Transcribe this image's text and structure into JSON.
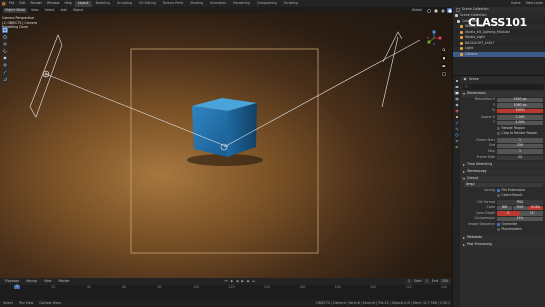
{
  "menu": {
    "items": [
      "File",
      "Edit",
      "Render",
      "Window",
      "Help"
    ],
    "workspaces": [
      "Layout",
      "Modeling",
      "Sculpting",
      "UV Editing",
      "Texture Paint",
      "Shading",
      "Animation",
      "Rendering",
      "Compositing",
      "Scripting"
    ],
    "active_workspace": "Layout",
    "scene": "Scene",
    "view_layer": "View Layer"
  },
  "viewport": {
    "mode": "Object Mode",
    "menus": [
      "View",
      "Select",
      "Add",
      "Object"
    ],
    "orientation": "Global",
    "info_lines": [
      "Camera Perspective",
      "(1) OBJECTS | Camera",
      "Rendering Done"
    ]
  },
  "timeline": {
    "playback": "Playback",
    "keying": "Keying",
    "view": "View",
    "marker": "Marker",
    "current_frame": "1",
    "start_label": "Start",
    "start": "1",
    "end_label": "End",
    "end": "250",
    "ticks": [
      "0",
      "20",
      "40",
      "60",
      "80",
      "100",
      "120",
      "140",
      "160",
      "180",
      "200",
      "220",
      "240"
    ]
  },
  "status": {
    "items": [
      "Select",
      "Pan View",
      "Context Menu"
    ],
    "version": "OBJECTS | Camera | Verts:8 | Faces:6 | Tris:12 | Objects:1/5 | Mem: 32.7 MiB | 2.90.1"
  },
  "watermark": "CLASS101",
  "outliner": {
    "title": "Scene Collection",
    "items": [
      {
        "label": "Scene Collection",
        "color": "#cccccc",
        "selected": false
      },
      {
        "label": "Collection",
        "color": "#cccccc",
        "selected": false
      },
      {
        "label": "Studio_Floor",
        "color": "#e6a33a",
        "selected": false
      },
      {
        "label": "Studio_Kit_Lighting_Modular",
        "color": "#e6a33a",
        "selected": false
      },
      {
        "label": "Studio_Light",
        "color": "#e6a33a",
        "selected": false
      },
      {
        "label": "BACKLIGHT_LIGHT",
        "color": "#e6a33a",
        "selected": false
      },
      {
        "label": "Light",
        "color": "#e6a33a",
        "selected": false
      },
      {
        "label": "Camera",
        "color": "#e6a33a",
        "selected": true
      }
    ]
  },
  "properties": {
    "breadcrumb": "Scene",
    "search_placeholder": "",
    "dimensions": {
      "header": "Dimensions",
      "rows": [
        {
          "label": "Resolution X",
          "value": "1920 px"
        },
        {
          "label": "Y",
          "value": "1080 px"
        },
        {
          "label": "%",
          "value": "100%",
          "accent": true
        },
        {
          "label": "Aspect X",
          "value": "1.000"
        },
        {
          "label": "Y",
          "value": "1.000"
        }
      ],
      "checks": [
        {
          "label": "Render Region",
          "on": false
        },
        {
          "label": "Crop to Render Region",
          "on": false
        }
      ],
      "frame_rows": [
        {
          "label": "Frame Start",
          "value": "1"
        },
        {
          "label": "End",
          "value": "250"
        },
        {
          "label": "Step",
          "value": "1"
        },
        {
          "label": "Frame Rate",
          "value": "24"
        }
      ]
    },
    "time_stretching": "Time Stretching",
    "stereoscopy": "Stereoscopy",
    "output": {
      "header": "Output",
      "path": "/tmp/",
      "rows": [
        {
          "label": "Saving",
          "check": "File Extensions",
          "on": true
        },
        {
          "label": "",
          "check": "Cache Result",
          "on": false
        }
      ],
      "file_format_label": "File Format",
      "file_format": "PNG",
      "color_label": "Color",
      "color_options": [
        "BW",
        "RGB",
        "RGBA"
      ],
      "color_selected": "RGBA",
      "depth_label": "Color Depth",
      "depth_options": [
        "8",
        "16"
      ],
      "depth_selected": "8",
      "compression_label": "Compression",
      "compression": "15%",
      "seq_label": "Image Sequence",
      "seq_checks": [
        {
          "label": "Overwrite",
          "on": true
        },
        {
          "label": "Placeholders",
          "on": false
        }
      ]
    },
    "metadata": "Metadata",
    "post_processing": "Post Processing"
  }
}
